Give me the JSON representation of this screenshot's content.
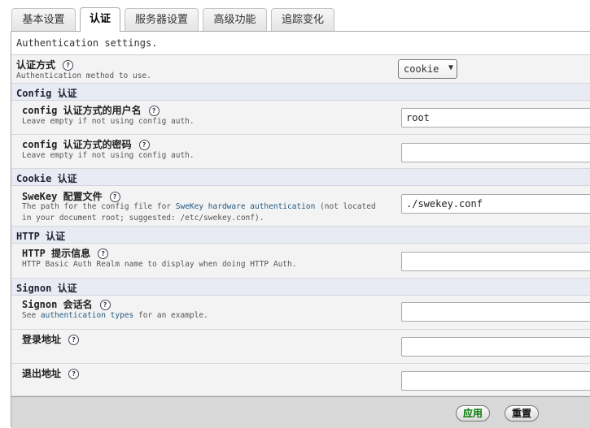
{
  "tabs": [
    "基本设置",
    "认证",
    "服务器设置",
    "高级功能",
    "追踪变化"
  ],
  "intro": "Authentication settings.",
  "auth_type": {
    "label": "认证方式",
    "help": "?",
    "desc": "Authentication method to use.",
    "value": "cookie",
    "arrow": "▼"
  },
  "config_group": "Config 认证",
  "config_user": {
    "label": "config 认证方式的用户名",
    "help": "?",
    "desc": "Leave empty if not using config auth.",
    "value": "root"
  },
  "config_pass": {
    "label": "config 认证方式的密码",
    "help": "?",
    "desc": "Leave empty if not using config auth.",
    "value": ""
  },
  "cookie_group": "Cookie 认证",
  "swekey": {
    "label": "SweKey 配置文件",
    "help": "?",
    "desc_before": "The path for the config file for ",
    "desc_link": "SweKey hardware authentication",
    "desc_after": " (not located",
    "desc_line2": "in your document root; suggested: /etc/swekey.conf).",
    "value": "./swekey.conf"
  },
  "http_group": "HTTP 认证",
  "http_realm": {
    "label": "HTTP 提示信息",
    "help": "?",
    "desc": "HTTP Basic Auth Realm name to display when doing HTTP Auth.",
    "value": ""
  },
  "signon_group": "Signon 认证",
  "signon_session": {
    "label": "Signon 会话名",
    "help": "?",
    "desc_before": "See ",
    "desc_link": "authentication types",
    "desc_after": " for an example.",
    "value": ""
  },
  "login_url": {
    "label": "登录地址",
    "help": "?",
    "value": ""
  },
  "logout_url": {
    "label": "退出地址",
    "help": "?",
    "value": ""
  },
  "buttons": {
    "apply": "应用",
    "reset": "重置"
  },
  "colors": {
    "apply_text": "#007700",
    "link": "#235a81"
  }
}
